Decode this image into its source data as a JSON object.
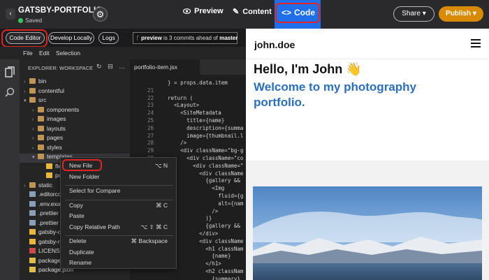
{
  "header": {
    "project_title": "GATSBY-PORTFOLIO",
    "save_status": "Saved",
    "tabs": [
      {
        "label": "Preview",
        "icon": "eye-icon"
      },
      {
        "label": "Content",
        "icon": "pencil-icon"
      },
      {
        "label": "Code",
        "icon": "code-icon"
      }
    ],
    "active_tab": "Code",
    "share_label": "Share ▾",
    "publish_label": "Publish ▾"
  },
  "toolbar": {
    "code_editor": "Code Editor",
    "develop_locally": "Develop Locally",
    "logs": "Logs",
    "branch_name": "preview",
    "branch_mid": " is 3 commits ahead of ",
    "branch_target": "master"
  },
  "menubar": [
    "File",
    "Edit",
    "Selection"
  ],
  "explorer": {
    "title": "EXPLORER: WORKSPACE",
    "items": [
      {
        "label": "bin",
        "kind": "folder",
        "depth": 0,
        "open": false
      },
      {
        "label": "contentful",
        "kind": "folder",
        "depth": 0,
        "open": false
      },
      {
        "label": "src",
        "kind": "folder",
        "depth": 0,
        "open": true
      },
      {
        "label": "components",
        "kind": "folder",
        "depth": 1,
        "open": false
      },
      {
        "label": "images",
        "kind": "folder",
        "depth": 1,
        "open": false
      },
      {
        "label": "layouts",
        "kind": "folder",
        "depth": 1,
        "open": false
      },
      {
        "label": "pages",
        "kind": "folder",
        "depth": 1,
        "open": false
      },
      {
        "label": "styles",
        "kind": "folder",
        "depth": 1,
        "open": false
      },
      {
        "label": "templates",
        "kind": "folder",
        "depth": 1,
        "open": true
      },
      {
        "label": "flexibl",
        "kind": "js",
        "depth": 2
      },
      {
        "label": "portfo",
        "kind": "js",
        "depth": 2
      },
      {
        "label": "static",
        "kind": "folder",
        "depth": 0,
        "open": false
      },
      {
        "label": ".editorco",
        "kind": "dot",
        "depth": 0
      },
      {
        "label": ".env.exa",
        "kind": "dot",
        "depth": 0
      },
      {
        "label": ".prettier",
        "kind": "dot",
        "depth": 0
      },
      {
        "label": ".prettier",
        "kind": "dot",
        "depth": 0
      },
      {
        "label": "gatsby-c",
        "kind": "js",
        "depth": 0
      },
      {
        "label": "gatsby-r",
        "kind": "js",
        "depth": 0
      },
      {
        "label": "LICENSE",
        "kind": "lic",
        "depth": 0
      },
      {
        "label": "package",
        "kind": "json",
        "depth": 0
      },
      {
        "label": "package.json",
        "kind": "json",
        "depth": 0
      }
    ]
  },
  "editor": {
    "tab_label": "portfolio-item.jsx",
    "lines": [
      {
        "n": "",
        "code": "  } = props.data.item"
      },
      {
        "n": "21",
        "code": ""
      },
      {
        "n": "22",
        "code": "  return ("
      },
      {
        "n": "23",
        "code": "    <Layout>"
      },
      {
        "n": "24",
        "code": "      <SiteMetadata"
      },
      {
        "n": "25",
        "code": "        title={name}"
      },
      {
        "n": "26",
        "code": "        description={summa"
      },
      {
        "n": "27",
        "code": "        image={thumbnail.l"
      },
      {
        "n": "28",
        "code": "      />"
      },
      {
        "n": "29",
        "code": "      <div className=\"bg-g"
      },
      {
        "n": "30",
        "code": "        <div className=\"co"
      },
      {
        "n": "",
        "code": "          <div className=\""
      },
      {
        "n": "",
        "code": "            <div className"
      },
      {
        "n": "",
        "code": "              {gallery &&"
      },
      {
        "n": "",
        "code": "                <Img"
      },
      {
        "n": "",
        "code": "                  fluid={g"
      },
      {
        "n": "",
        "code": "                  alt={nam"
      },
      {
        "n": "",
        "code": "                />"
      },
      {
        "n": "",
        "code": "              )}"
      },
      {
        "n": "",
        "code": "              {gallery &&"
      },
      {
        "n": "",
        "code": "            </div>"
      },
      {
        "n": "",
        "code": "            <div className"
      },
      {
        "n": "",
        "code": "              <h1 classNam"
      },
      {
        "n": "",
        "code": "                {name}"
      },
      {
        "n": "",
        "code": "              </h1>"
      },
      {
        "n": "",
        "code": "              <h2 classNam"
      },
      {
        "n": "",
        "code": "                {summary}"
      }
    ]
  },
  "context_menu": {
    "items": [
      {
        "label": "New File",
        "key": "⌥ N"
      },
      {
        "label": "New Folder",
        "key": ""
      },
      {
        "sep": true
      },
      {
        "label": "Select for Compare",
        "key": ""
      },
      {
        "sep": true
      },
      {
        "label": "Copy",
        "key": "⌘ C"
      },
      {
        "label": "Paste",
        "key": ""
      },
      {
        "label": "Copy Relative Path",
        "key": "⌥ ⇧ ⌘ C"
      },
      {
        "sep": true
      },
      {
        "label": "Delete",
        "key": "⌘ Backspace"
      },
      {
        "label": "Duplicate",
        "key": ""
      },
      {
        "label": "Rename",
        "key": ""
      }
    ]
  },
  "preview": {
    "site_name": "john.doe",
    "heading": "Hello, I'm John 👋",
    "subheading": "Welcome to my photography portfolio.",
    "accent_color": "#2b6fbf"
  },
  "colors": {
    "code_tab_bg": "#1f6feb",
    "publish_bg": "#d98b00",
    "highlight_red": "#e02424",
    "saved_green": "#34c759"
  }
}
